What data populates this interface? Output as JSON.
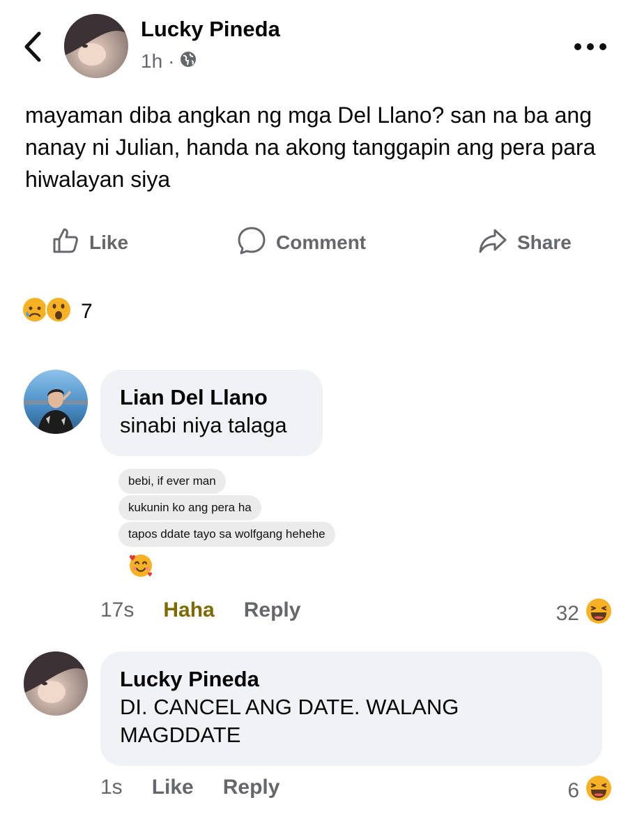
{
  "header": {
    "back_icon": "chevron-left-icon",
    "author": "Lucky Pineda",
    "time": "1h",
    "separator": "·",
    "privacy_icon": "globe-icon",
    "more_icon": "more-horizontal-icon"
  },
  "post": {
    "text": "mayaman diba angkan ng mga Del Llano? san na ba ang nanay ni Julian, handa na akong tanggapin ang pera para hiwalayan siya"
  },
  "actions": {
    "like": "Like",
    "comment": "Comment",
    "share": "Share"
  },
  "reactions": {
    "icons": [
      "sad-emoji-icon",
      "wow-emoji-icon"
    ],
    "count": "7"
  },
  "comments": [
    {
      "author": "Lian Del Llano",
      "text": "sinabi niya talaga",
      "attached_chat": [
        "bebi, if ever man",
        "kukunin ko ang pera ha",
        "tapos ddate tayo sa wolfgang hehehe"
      ],
      "attached_emoji": "smiling-face-with-hearts-emoji-icon",
      "time": "17s",
      "reaction_label": "Haha",
      "reply_label": "Reply",
      "reaction_count": "32",
      "reaction_icon": "haha-emoji-icon",
      "accent_color": "#7d6a00"
    },
    {
      "author": "Lucky Pineda",
      "text": "DI. CANCEL ANG DATE. WALANG MAGDDATE",
      "time": "1s",
      "like_label": "Like",
      "reply_label": "Reply",
      "reaction_count": "6",
      "reaction_icon": "haha-emoji-icon"
    }
  ]
}
